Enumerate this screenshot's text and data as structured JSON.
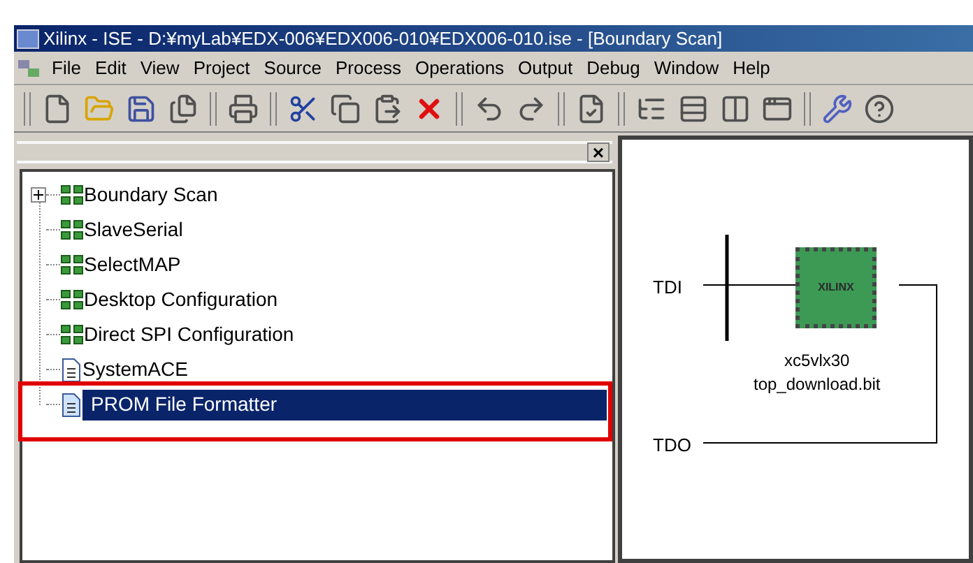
{
  "window": {
    "title": "Xilinx - ISE - D:¥myLab¥EDX-006¥EDX006-010¥EDX006-010.ise - [Boundary Scan]"
  },
  "menu": [
    {
      "label": "File"
    },
    {
      "label": "Edit"
    },
    {
      "label": "View"
    },
    {
      "label": "Project"
    },
    {
      "label": "Source"
    },
    {
      "label": "Process"
    },
    {
      "label": "Operations"
    },
    {
      "label": "Output"
    },
    {
      "label": "Debug"
    },
    {
      "label": "Window"
    },
    {
      "label": "Help"
    }
  ],
  "tree": {
    "items": [
      {
        "label": "Boundary Scan",
        "kind": "chain",
        "expandable": true,
        "selected": false
      },
      {
        "label": "SlaveSerial",
        "kind": "chain",
        "expandable": false,
        "selected": false
      },
      {
        "label": "SelectMAP",
        "kind": "chain",
        "expandable": false,
        "selected": false
      },
      {
        "label": "Desktop Configuration",
        "kind": "chain",
        "expandable": false,
        "selected": false
      },
      {
        "label": "Direct SPI Configuration",
        "kind": "chain",
        "expandable": false,
        "selected": false
      },
      {
        "label": "SystemACE",
        "kind": "doc",
        "expandable": false,
        "selected": false
      },
      {
        "label": "PROM File Formatter",
        "kind": "prom",
        "expandable": false,
        "selected": true
      }
    ],
    "close": "×"
  },
  "diagram": {
    "tdi": "TDI",
    "tdo": "TDO",
    "chip_logo": "XILINX",
    "device": "xc5vlx30",
    "file": "top_download.bit"
  }
}
